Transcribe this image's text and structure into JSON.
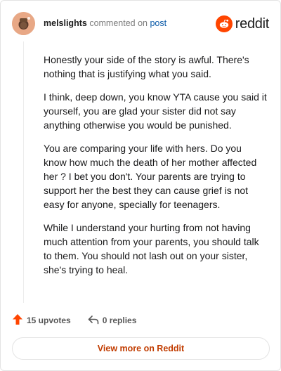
{
  "header": {
    "username": "melslights",
    "action_text": "commented on",
    "post_link": "post",
    "brand": "reddit"
  },
  "comment": {
    "paragraphs": [
      "Honestly your side of the story is awful. There's nothing that is justifying what you said.",
      "I think, deep down, you know YTA cause you said it yourself, you are glad your sister did not say anything otherwise you would be punished.",
      "You are comparing your life with hers. Do you know how much the death of her mother affected her ? I bet you don't. Your parents are trying to support her the best they can cause grief is not easy for anyone, specially for teenagers.",
      "While I understand your hurting from not having much attention from your parents, you should talk to them. You should not lash out on your sister, she's trying to heal."
    ]
  },
  "footer": {
    "upvotes": "15 upvotes",
    "replies": "0 replies",
    "view_more": "View more on Reddit"
  },
  "colors": {
    "accent": "#ff4500",
    "link": "#0a5aa8",
    "view_more_text": "#c13c00"
  },
  "icons": {
    "avatar": "avatar-icon",
    "logo": "reddit-logo-icon",
    "upvote": "upvote-arrow-icon",
    "reply": "reply-arrow-icon"
  }
}
